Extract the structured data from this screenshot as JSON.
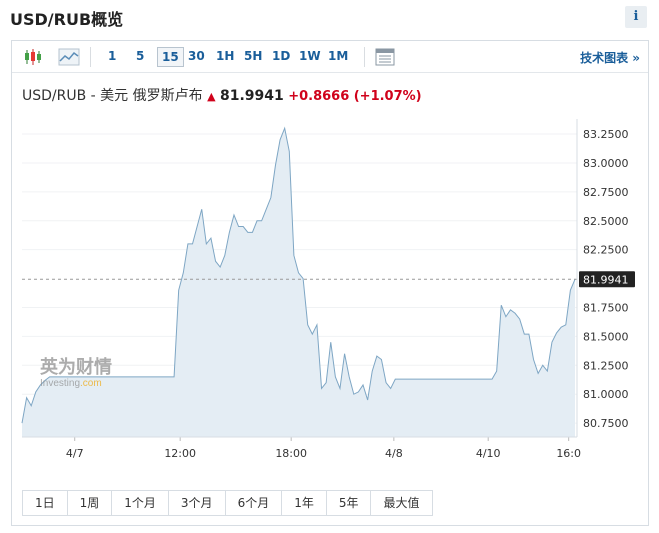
{
  "page": {
    "title": "USD/RUB概览",
    "info_label": "i"
  },
  "toolbar": {
    "ranges": [
      "1",
      "5",
      "15",
      "30",
      "1H",
      "5H",
      "1D",
      "1W",
      "1M"
    ],
    "active_range": "15",
    "tech_link": "技术图表 »"
  },
  "quote": {
    "pair_label": "USD/RUB - 美元 俄罗斯卢布",
    "price": "81.9941",
    "change": "+0.8666",
    "change_pct": "(+1.07%)",
    "direction": "up"
  },
  "watermark": {
    "cn": "英为财情",
    "en": "Investing",
    "suffix": ".com"
  },
  "chart_data": {
    "type": "area",
    "x_tick_labels": [
      "4/7",
      "12:00",
      "18:00",
      "4/8",
      "4/10",
      "16:0"
    ],
    "y_tick_labels": [
      "83.2500",
      "83.0000",
      "82.7500",
      "82.5000",
      "82.2500",
      "81.7500",
      "81.5000",
      "81.2500",
      "81.0000",
      "80.7500"
    ],
    "ylim": [
      80.63,
      83.38
    ],
    "current_value": "81.9941",
    "series": [
      {
        "values": [
          80.75,
          80.97,
          80.9,
          81.02,
          81.08,
          81.12,
          81.15,
          81.15,
          81.15,
          81.15,
          81.15,
          81.15,
          81.15,
          81.15,
          81.15,
          81.15,
          81.15,
          81.15,
          81.15,
          81.15,
          81.15,
          81.15,
          81.15,
          81.15,
          81.15,
          81.15,
          81.15,
          81.15,
          81.15,
          81.15,
          81.15,
          81.15,
          81.15,
          81.15,
          81.9,
          82.05,
          82.3,
          82.3,
          82.45,
          82.6,
          82.3,
          82.35,
          82.15,
          82.1,
          82.2,
          82.4,
          82.55,
          82.45,
          82.45,
          82.4,
          82.4,
          82.5,
          82.5,
          82.6,
          82.7,
          82.98,
          83.2,
          83.3,
          83.1,
          82.2,
          82.05,
          82.0,
          81.6,
          81.52,
          81.6,
          81.05,
          81.1,
          81.45,
          81.15,
          81.05,
          81.35,
          81.15,
          81.0,
          81.02,
          81.08,
          80.95,
          81.2,
          81.33,
          81.3,
          81.1,
          81.05,
          81.13,
          81.13,
          81.13,
          81.13,
          81.13,
          81.13,
          81.13,
          81.13,
          81.13,
          81.13,
          81.13,
          81.13,
          81.13,
          81.13,
          81.13,
          81.13,
          81.13,
          81.13,
          81.13,
          81.13,
          81.13,
          81.13,
          81.2,
          81.77,
          81.67,
          81.73,
          81.7,
          81.65,
          81.52,
          81.52,
          81.3,
          81.18,
          81.25,
          81.2,
          81.45,
          81.53,
          81.58,
          81.6,
          81.9,
          81.9941
        ]
      }
    ],
    "colors": {
      "line": "#7ea6c4",
      "fill": "#e4edf4",
      "label_bg": "#222222",
      "up": "#d0021b"
    }
  },
  "periods": [
    "1日",
    "1周",
    "1个月",
    "3个月",
    "6个月",
    "1年",
    "5年",
    "最大值"
  ]
}
